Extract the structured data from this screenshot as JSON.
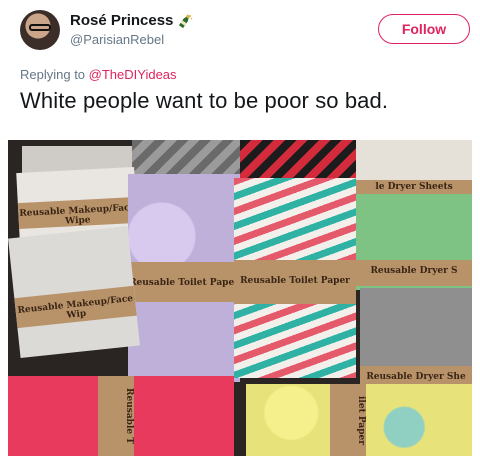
{
  "user": {
    "name": "Rosé Princess",
    "handle": "@ParisianRebel",
    "emoji_icon": "champagne-bottle-icon"
  },
  "follow_button": {
    "label": "Follow"
  },
  "reply": {
    "prefix": "Replying to",
    "mention": "@TheDIYideas"
  },
  "tweet": {
    "text": "White people want to be poor so bad."
  },
  "photo": {
    "labels": {
      "toilet_1": "Reusable Toilet Paper",
      "toilet_2": "Reusable Toilet Paper",
      "makeup_1": "Reusable Makeup/Face Wipe",
      "makeup_2": "Reusable Makeup/Face Wip",
      "dryer_1": "le Dryer Sheets",
      "dryer_2": "Reusable Dryer S",
      "dryer_3": "Reusable Dryer She",
      "bottom_1": "Reusable T",
      "bottom_2": "ilet Paper"
    }
  },
  "colors": {
    "accent": "#e0245e",
    "text": "#14171a",
    "muted": "#657786"
  }
}
